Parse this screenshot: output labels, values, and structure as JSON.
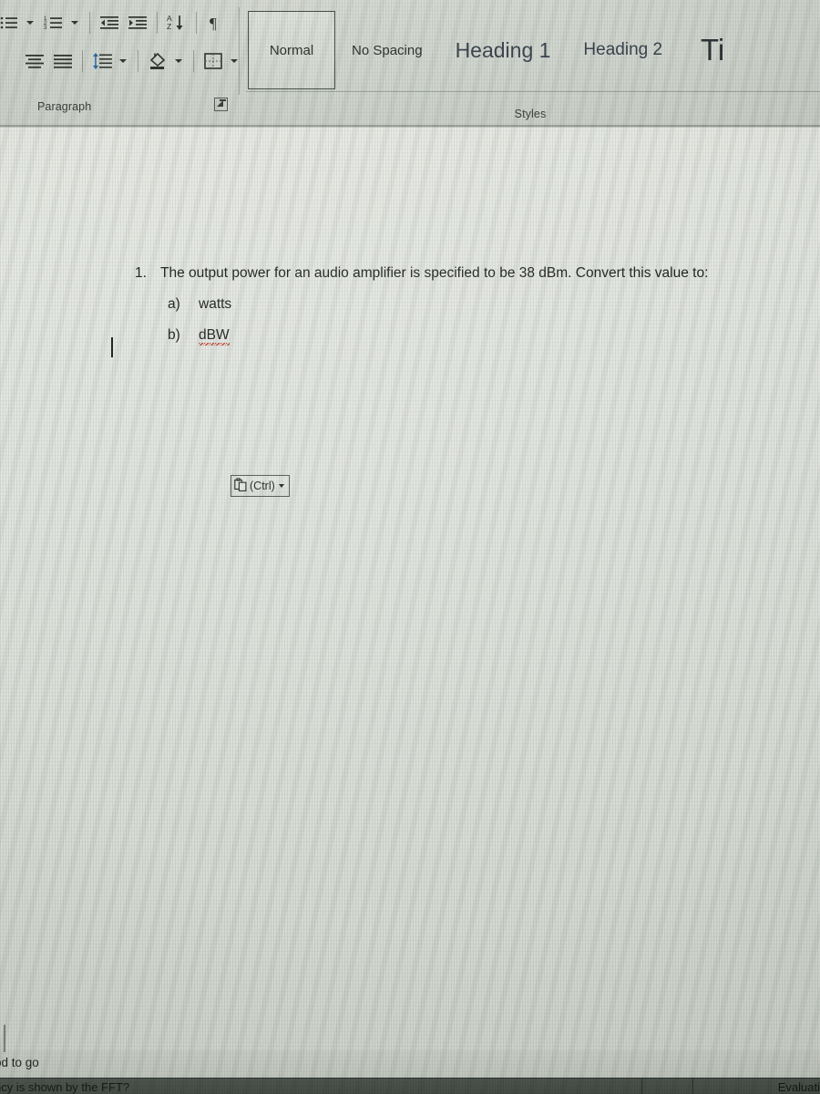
{
  "ribbon": {
    "paragraph_group": {
      "label": "Paragraph",
      "dialog_launcher": "paragraph-dialog-launcher",
      "row1": [
        {
          "name": "bullets-icon",
          "label": "Bullets"
        },
        {
          "name": "bullets-dropdown-caret",
          "label": "Bullets options"
        },
        {
          "name": "numbering-icon",
          "label": "Numbering"
        },
        {
          "name": "numbering-dropdown-caret",
          "label": "Numbering options"
        },
        {
          "name": "decrease-indent-icon",
          "label": "Decrease Indent"
        },
        {
          "name": "increase-indent-icon",
          "label": "Increase Indent"
        },
        {
          "name": "sort-icon",
          "label": "Sort"
        },
        {
          "name": "show-formatting-marks-icon",
          "label": "Show/Hide ¶"
        }
      ],
      "row2": [
        {
          "name": "align-center-icon",
          "label": "Center"
        },
        {
          "name": "align-justify-icon",
          "label": "Justify"
        },
        {
          "name": "line-spacing-icon",
          "label": "Line and Paragraph Spacing"
        },
        {
          "name": "line-spacing-dropdown-caret",
          "label": "Line spacing options"
        },
        {
          "name": "shading-icon",
          "label": "Shading"
        },
        {
          "name": "shading-dropdown-caret",
          "label": "Shading options"
        },
        {
          "name": "borders-icon",
          "label": "Borders"
        },
        {
          "name": "borders-dropdown-caret",
          "label": "Borders options"
        }
      ]
    },
    "styles_group": {
      "label": "Styles",
      "items": [
        {
          "label": "Normal",
          "selected": true
        },
        {
          "label": "No Spacing",
          "selected": false
        },
        {
          "label": "Heading 1",
          "selected": false
        },
        {
          "label": "Heading 2",
          "selected": false
        },
        {
          "label": "Ti",
          "selected": false
        }
      ]
    }
  },
  "document": {
    "question_number": "1.",
    "question_text": "The output power for an audio amplifier is specified to be 38 dBm. Convert this value to:",
    "sub_items": [
      {
        "label": "a)",
        "text": "watts",
        "misspelled": false
      },
      {
        "label": "b)",
        "text": "dBW",
        "misspelled": true
      }
    ],
    "paste_options": {
      "icon": "clipboard-icon",
      "label": "(Ctrl)"
    }
  },
  "status": {
    "upper_band_text": "od to go",
    "lower_band_left_text": "ncy is shown by the FFT?",
    "lower_band_right_text": "Evaluati"
  },
  "colors": {
    "ribbon_background": "#d2d7d0",
    "document_background": "#e3e7e1",
    "text": "#11150f",
    "heading_accent": "#2f3a44",
    "spellcheck_underline": "#c0392b",
    "status_dark_band": "#4b534d"
  }
}
